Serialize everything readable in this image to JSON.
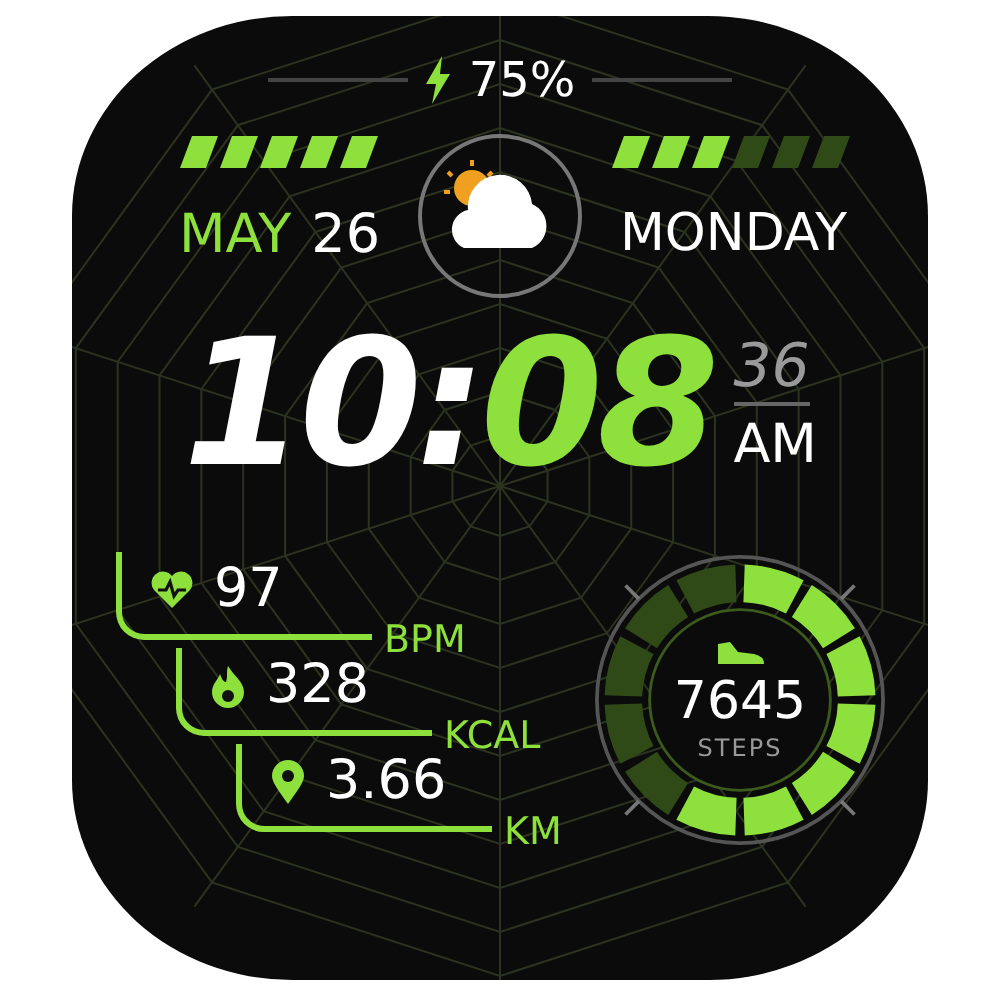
{
  "battery": {
    "value": "75%"
  },
  "left_bar": {
    "level": 1
  },
  "right_bar": {
    "level": 0.5
  },
  "date": {
    "month": "MAY",
    "day": "26",
    "weekday": "MONDAY"
  },
  "time": {
    "hours": "10",
    "separator": ":",
    "minutes": "08",
    "seconds": "36",
    "period": "AM"
  },
  "stats": [
    {
      "kind": "heart",
      "value": "97",
      "unit": "BPM"
    },
    {
      "kind": "flame",
      "value": "328",
      "unit": "KCAL"
    },
    {
      "kind": "pin",
      "value": "3.66",
      "unit": "KM"
    }
  ],
  "steps": {
    "value": "7645",
    "label": "STEPS",
    "level": 0.58
  }
}
